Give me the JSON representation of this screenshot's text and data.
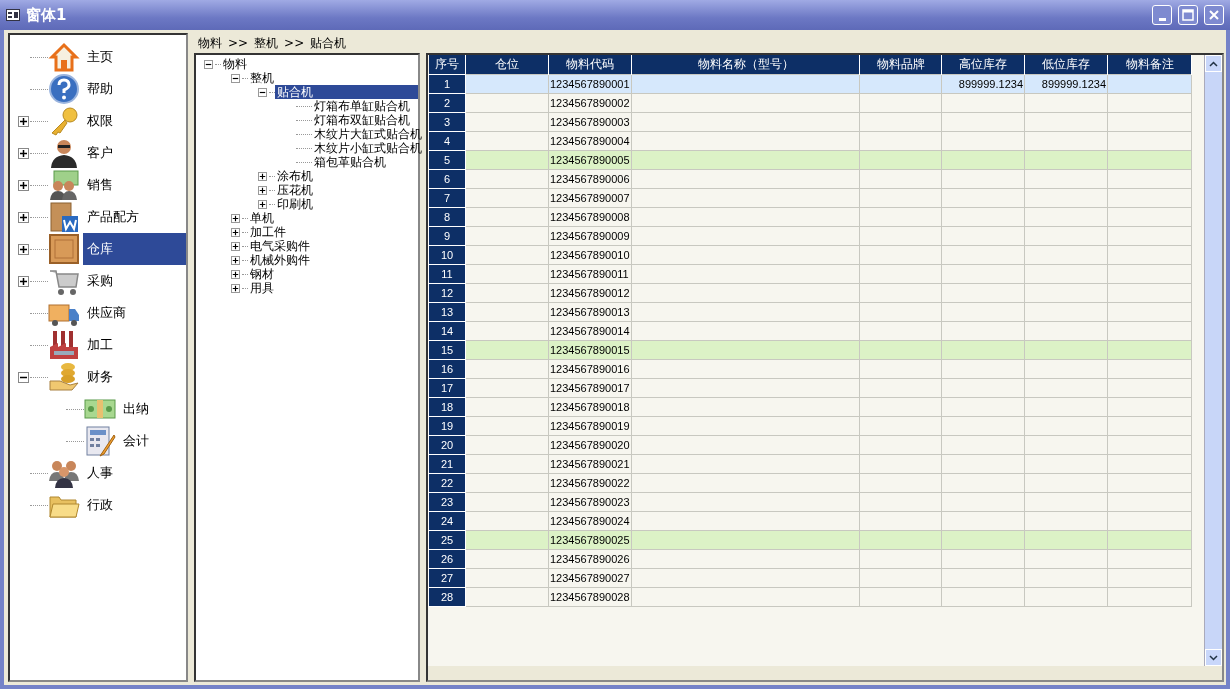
{
  "window": {
    "title": "窗体1"
  },
  "nav": [
    {
      "label": "主页",
      "selected": false
    },
    {
      "label": "帮助",
      "selected": false
    },
    {
      "label": "权限",
      "selected": false,
      "expanded": false
    },
    {
      "label": "客户",
      "selected": false,
      "expanded": false
    },
    {
      "label": "销售",
      "selected": false,
      "expanded": false
    },
    {
      "label": "产品配方",
      "selected": false,
      "expanded": false
    },
    {
      "label": "仓库",
      "selected": true,
      "expanded": false
    },
    {
      "label": "采购",
      "selected": false,
      "expanded": false
    },
    {
      "label": "供应商",
      "selected": false
    },
    {
      "label": "加工",
      "selected": false
    },
    {
      "label": "财务",
      "selected": false,
      "expanded": true,
      "children": [
        {
          "label": "出纳",
          "selected": false
        },
        {
          "label": "会计",
          "selected": false
        }
      ]
    },
    {
      "label": "人事",
      "selected": false
    },
    {
      "label": "行政",
      "selected": false
    }
  ],
  "breadcrumb": [
    "物料",
    "整机",
    "贴合机"
  ],
  "breadcrumb_separator": ">>",
  "tree": [
    {
      "label": "物料",
      "selected": false,
      "expanded": true,
      "children": [
        {
          "label": "整机",
          "selected": false,
          "expanded": true,
          "children": [
            {
              "label": "贴合机",
              "selected": true,
              "expanded": true,
              "children": [
                {
                  "label": "灯箱布单缸贴合机",
                  "selected": false
                },
                {
                  "label": "灯箱布双缸贴合机",
                  "selected": false
                },
                {
                  "label": "木纹片大缸式贴合机",
                  "selected": false
                },
                {
                  "label": "木纹片小缸式贴合机",
                  "selected": false
                },
                {
                  "label": "箱包革贴合机",
                  "selected": false
                }
              ]
            },
            {
              "label": "涂布机",
              "selected": false,
              "expanded": false
            },
            {
              "label": "压花机",
              "selected": false,
              "expanded": false
            },
            {
              "label": "印刷机",
              "selected": false,
              "expanded": false
            }
          ]
        },
        {
          "label": "单机",
          "selected": false,
          "expanded": false
        },
        {
          "label": "加工件",
          "selected": false,
          "expanded": false
        },
        {
          "label": "电气采购件",
          "selected": false,
          "expanded": false
        },
        {
          "label": "机械外购件",
          "selected": false,
          "expanded": false
        },
        {
          "label": "钢材",
          "selected": false,
          "expanded": false
        },
        {
          "label": "用具",
          "selected": false,
          "expanded": false
        }
      ]
    }
  ],
  "table": {
    "columns": [
      "序号",
      "仓位",
      "物料代码",
      "物料名称（型号）",
      "物料品牌",
      "高位库存",
      "低位库存",
      "物料备注"
    ],
    "rows": [
      {
        "index": "1",
        "code": "1234567890001",
        "high_stock": "899999.1234",
        "low_stock": "899999.1234",
        "selected": true,
        "tinted": false
      },
      {
        "index": "2",
        "code": "1234567890002",
        "selected": false,
        "tinted": false
      },
      {
        "index": "3",
        "code": "1234567890003",
        "selected": false,
        "tinted": false
      },
      {
        "index": "4",
        "code": "1234567890004",
        "selected": false,
        "tinted": false
      },
      {
        "index": "5",
        "code": "1234567890005",
        "selected": false,
        "tinted": true
      },
      {
        "index": "6",
        "code": "1234567890006",
        "selected": false,
        "tinted": false
      },
      {
        "index": "7",
        "code": "1234567890007",
        "selected": false,
        "tinted": false
      },
      {
        "index": "8",
        "code": "1234567890008",
        "selected": false,
        "tinted": false
      },
      {
        "index": "9",
        "code": "1234567890009",
        "selected": false,
        "tinted": false
      },
      {
        "index": "10",
        "code": "1234567890010",
        "selected": false,
        "tinted": false
      },
      {
        "index": "11",
        "code": "1234567890011",
        "selected": false,
        "tinted": false
      },
      {
        "index": "12",
        "code": "1234567890012",
        "selected": false,
        "tinted": false
      },
      {
        "index": "13",
        "code": "1234567890013",
        "selected": false,
        "tinted": false
      },
      {
        "index": "14",
        "code": "1234567890014",
        "selected": false,
        "tinted": false
      },
      {
        "index": "15",
        "code": "1234567890015",
        "selected": false,
        "tinted": true
      },
      {
        "index": "16",
        "code": "1234567890016",
        "selected": false,
        "tinted": false
      },
      {
        "index": "17",
        "code": "1234567890017",
        "selected": false,
        "tinted": false
      },
      {
        "index": "18",
        "code": "1234567890018",
        "selected": false,
        "tinted": false
      },
      {
        "index": "19",
        "code": "1234567890019",
        "selected": false,
        "tinted": false
      },
      {
        "index": "20",
        "code": "1234567890020",
        "selected": false,
        "tinted": false
      },
      {
        "index": "21",
        "code": "1234567890021",
        "selected": false,
        "tinted": false
      },
      {
        "index": "22",
        "code": "1234567890022",
        "selected": false,
        "tinted": false
      },
      {
        "index": "23",
        "code": "1234567890023",
        "selected": false,
        "tinted": false
      },
      {
        "index": "24",
        "code": "1234567890024",
        "selected": false,
        "tinted": false
      },
      {
        "index": "25",
        "code": "1234567890025",
        "selected": false,
        "tinted": true
      },
      {
        "index": "26",
        "code": "1234567890026",
        "selected": false,
        "tinted": false
      },
      {
        "index": "27",
        "code": "1234567890027",
        "selected": false,
        "tinted": false
      },
      {
        "index": "28",
        "code": "1234567890028",
        "selected": false,
        "tinted": false
      }
    ]
  }
}
